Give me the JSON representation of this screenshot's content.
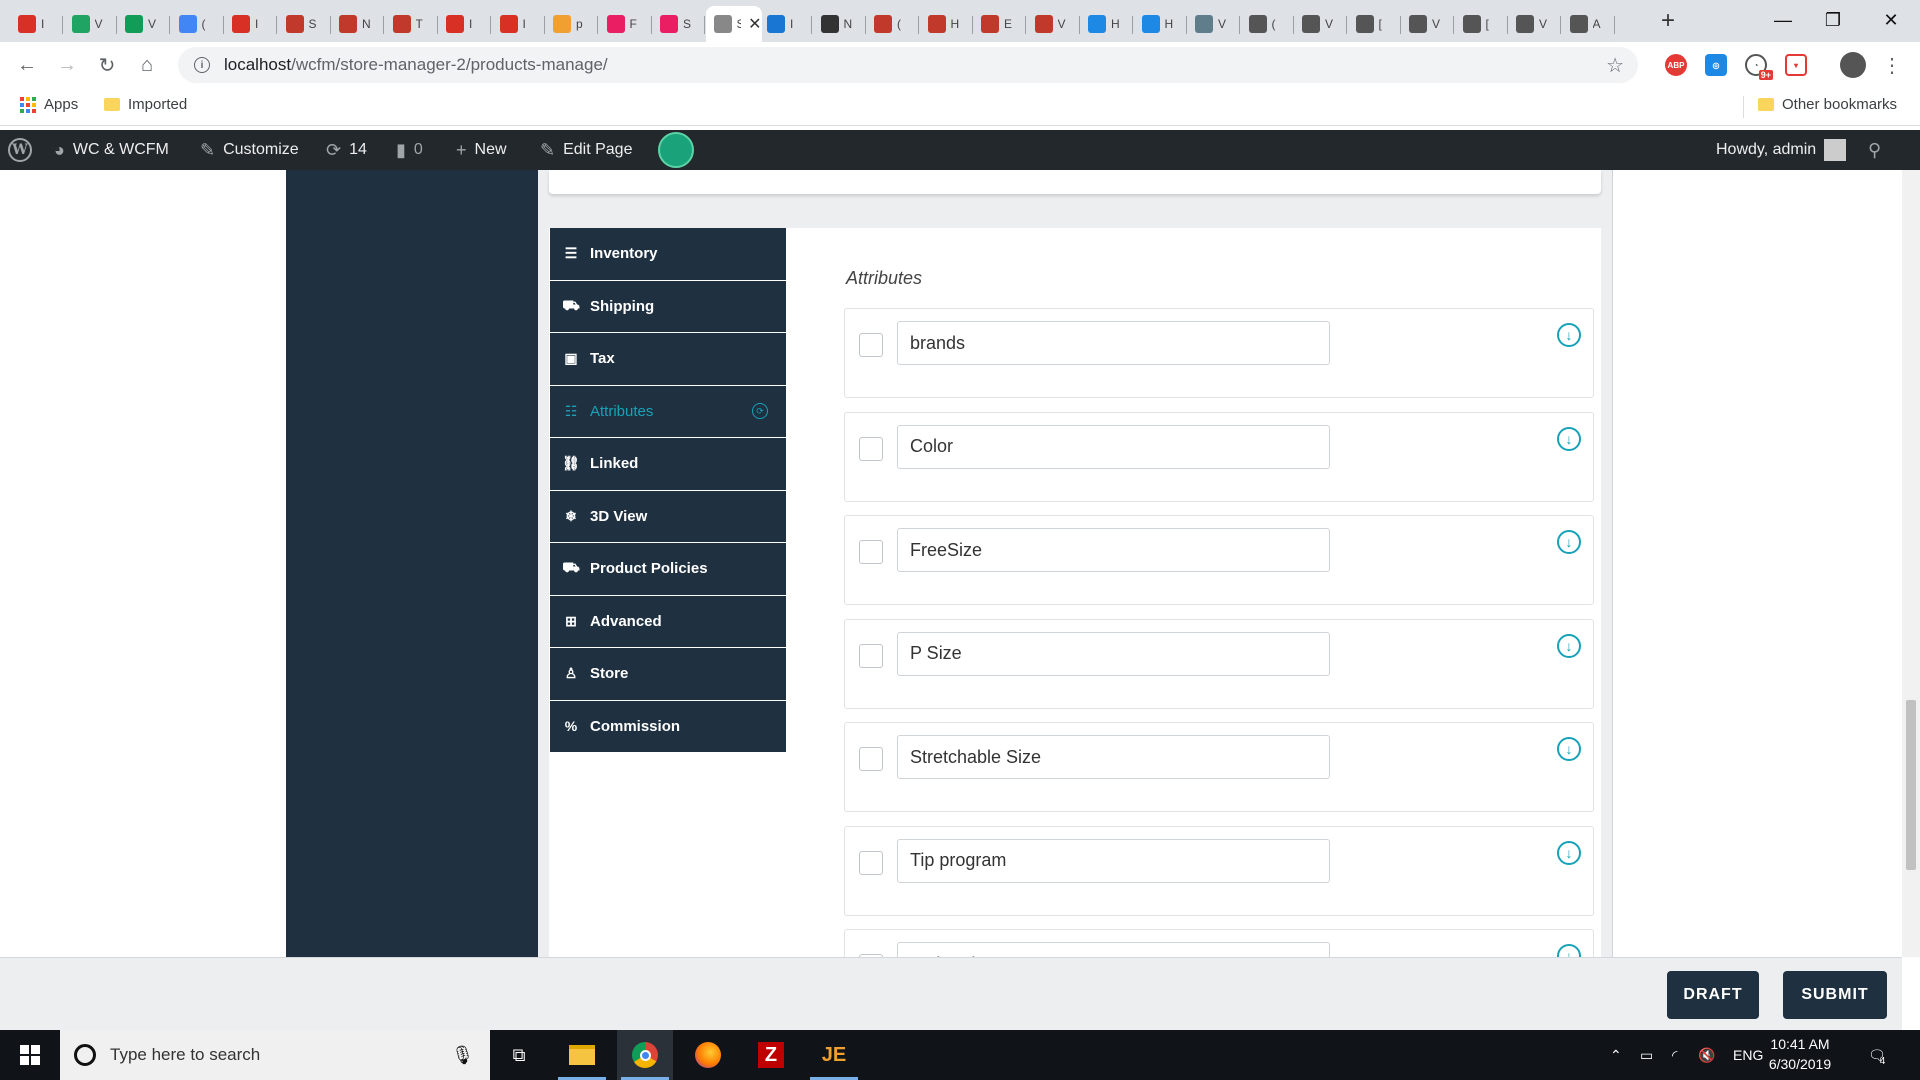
{
  "browser": {
    "tabs": [
      {
        "title": "I",
        "icon": "gmail-icon",
        "color": "#d93025"
      },
      {
        "title": "V",
        "icon": "drive-icon",
        "color": "#1fa463"
      },
      {
        "title": "V",
        "icon": "sheets-icon",
        "color": "#0f9d58"
      },
      {
        "title": "(",
        "icon": "cloud-icon",
        "color": "#4285f4"
      },
      {
        "title": "I",
        "icon": "gmail-icon",
        "color": "#d93025"
      },
      {
        "title": "S",
        "icon": "site-icon",
        "color": "#c0392b"
      },
      {
        "title": "N",
        "icon": "site-icon",
        "color": "#c0392b"
      },
      {
        "title": "T",
        "icon": "site-icon",
        "color": "#c0392b"
      },
      {
        "title": "I",
        "icon": "gmail-icon",
        "color": "#d93025"
      },
      {
        "title": "I",
        "icon": "gmail-icon",
        "color": "#d93025"
      },
      {
        "title": "p",
        "icon": "pma-icon",
        "color": "#f0a030"
      },
      {
        "title": "F",
        "icon": "pink-icon",
        "color": "#e91e63"
      },
      {
        "title": "S",
        "icon": "pink-icon",
        "color": "#e91e63"
      },
      {
        "title": "St",
        "icon": "active-tab-icon",
        "color": "#888888"
      },
      {
        "title": "I",
        "icon": "ibb-icon",
        "color": "#1976d2"
      },
      {
        "title": "N",
        "icon": "film-icon",
        "color": "#333333"
      },
      {
        "title": "(",
        "icon": "site-icon",
        "color": "#c0392b"
      },
      {
        "title": "H",
        "icon": "site-icon",
        "color": "#c0392b"
      },
      {
        "title": "E",
        "icon": "site-icon",
        "color": "#c0392b"
      },
      {
        "title": "V",
        "icon": "site-icon",
        "color": "#c0392b"
      },
      {
        "title": "H",
        "icon": "globe-icon",
        "color": "#1e88e5"
      },
      {
        "title": "H",
        "icon": "globe-icon",
        "color": "#1e88e5"
      },
      {
        "title": "V",
        "icon": "monitor-icon",
        "color": "#607d8b"
      },
      {
        "title": "(",
        "icon": "wordpress-icon",
        "color": "#555555"
      },
      {
        "title": "V",
        "icon": "wordpress-icon",
        "color": "#555555"
      },
      {
        "title": "[",
        "icon": "wordpress-icon",
        "color": "#555555"
      },
      {
        "title": "V",
        "icon": "wordpress-icon",
        "color": "#555555"
      },
      {
        "title": "[",
        "icon": "wordpress-icon",
        "color": "#555555"
      },
      {
        "title": "V",
        "icon": "wordpress-icon",
        "color": "#555555"
      },
      {
        "title": "A",
        "icon": "wordpress-icon",
        "color": "#555555"
      }
    ],
    "url_host": "localhost",
    "url_path": "/wcfm/store-manager-2/products-manage/",
    "bookmarks": {
      "apps": "Apps",
      "imported": "Imported",
      "other": "Other bookmarks"
    },
    "badge_count": "9+"
  },
  "wpbar": {
    "site": "WC & WCFM",
    "customize": "Customize",
    "updates": "14",
    "comments": "0",
    "new": "New",
    "edit": "Edit Page",
    "howdy": "Howdy, admin"
  },
  "sidenav": [
    {
      "label": "Inventory",
      "icon": "database-icon",
      "glyph": "☰",
      "active": false
    },
    {
      "label": "Shipping",
      "icon": "truck-icon",
      "glyph": "⛟",
      "active": false
    },
    {
      "label": "Tax",
      "icon": "money-icon",
      "glyph": "▣",
      "active": false
    },
    {
      "label": "Attributes",
      "icon": "list-icon",
      "glyph": "☷",
      "active": true
    },
    {
      "label": "Linked",
      "icon": "link-icon",
      "glyph": "⛓",
      "active": false
    },
    {
      "label": "3D View",
      "icon": "snowflake-icon",
      "glyph": "❄",
      "active": false
    },
    {
      "label": "Product Policies",
      "icon": "policy-truck-icon",
      "glyph": "⛟",
      "active": false
    },
    {
      "label": "Advanced",
      "icon": "table-icon",
      "glyph": "⊞",
      "active": false
    },
    {
      "label": "Store",
      "icon": "user-icon",
      "glyph": "♙",
      "active": false
    },
    {
      "label": "Commission",
      "icon": "percent-icon",
      "glyph": "%",
      "active": false
    }
  ],
  "attributes": {
    "heading": "Attributes",
    "items": [
      {
        "name": "brands"
      },
      {
        "name": "Color"
      },
      {
        "name": "FreeSize"
      },
      {
        "name": "P Size"
      },
      {
        "name": "Stretchable Size"
      },
      {
        "name": "Tip program"
      },
      {
        "name": "Waist Size"
      }
    ]
  },
  "footer": {
    "draft": "DRAFT",
    "submit": "SUBMIT"
  },
  "taskbar": {
    "search_placeholder": "Type here to search",
    "lang": "ENG",
    "time": "10:41 AM",
    "date": "6/30/2019",
    "notifications": "4"
  },
  "colors": {
    "accent": "#17a2b8",
    "nav_dark": "#1f3040",
    "wp_bar": "#23282d"
  }
}
